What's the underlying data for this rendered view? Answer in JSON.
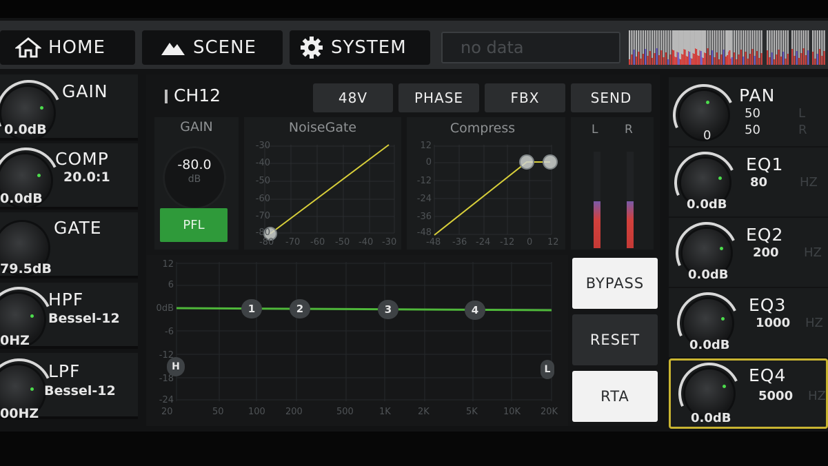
{
  "nav": {
    "home": "HOME",
    "scene": "SCENE",
    "system": "SYSTEM",
    "status": "no data"
  },
  "left": {
    "gain": {
      "label": "GAIN",
      "value": "0.0dB"
    },
    "comp": {
      "label": "COMP",
      "ratio": "20.0:1",
      "value": "0.0dB"
    },
    "gate": {
      "label": "GATE",
      "value": "79.5dB"
    },
    "hpf": {
      "label": "HPF",
      "type": "Bessel-12",
      "value": "0HZ"
    },
    "lpf": {
      "label": "LPF",
      "type": "Bessel-12",
      "value": "00HZ"
    }
  },
  "channel": {
    "name": "CH12",
    "buttons": {
      "v48": "48V",
      "phase": "PHASE",
      "fbx": "FBX",
      "send": "SEND"
    },
    "gain_title": "GAIN",
    "gain_value": "-80.0",
    "gain_unit": "dB",
    "pfl": "PFL",
    "noisegate_title": "NoiseGate",
    "compress_title": "Compress",
    "meter_l": "L",
    "meter_r": "R"
  },
  "noisegate_axis": {
    "y": [
      "-30",
      "-40",
      "-50",
      "-60",
      "-70",
      "-80"
    ],
    "x": [
      "-80",
      "-70",
      "-60",
      "-50",
      "-40",
      "-30"
    ]
  },
  "compress_axis": {
    "y": [
      "12",
      "0",
      "-12",
      "-24",
      "-36",
      "-48"
    ],
    "x": [
      "-48",
      "-36",
      "-24",
      "-12",
      "0",
      "12"
    ]
  },
  "eq_axis": {
    "y": [
      "12",
      "6",
      "0dB",
      "-6",
      "-12",
      "-18",
      "-24"
    ],
    "x": [
      "20",
      "50",
      "100",
      "200",
      "500",
      "1K",
      "2K",
      "5K",
      "10K",
      "20K"
    ],
    "bands": [
      "1",
      "2",
      "3",
      "4"
    ],
    "hpf_marker": "H",
    "lpf_marker": "L"
  },
  "actions": {
    "bypass": "BYPASS",
    "reset": "RESET",
    "rta": "RTA"
  },
  "right": {
    "pan": {
      "label": "PAN",
      "l": "50",
      "r": "50",
      "l_tag": "L",
      "r_tag": "R",
      "value": "0"
    },
    "eq1": {
      "label": "EQ1",
      "freq": "80",
      "unit": "HZ",
      "value": "0.0dB"
    },
    "eq2": {
      "label": "EQ2",
      "freq": "200",
      "unit": "HZ",
      "value": "0.0dB"
    },
    "eq3": {
      "label": "EQ3",
      "freq": "1000",
      "unit": "HZ",
      "value": "0.0dB"
    },
    "eq4": {
      "label": "EQ4",
      "freq": "5000",
      "unit": "HZ",
      "value": "0.0dB"
    }
  },
  "colors": {
    "accent_green": "#4cdc4c",
    "curve_yellow": "#d8cf3a",
    "pfl_green": "#2f9a3a",
    "selected_border": "#c9b431",
    "meter_red": "#d2403c"
  }
}
